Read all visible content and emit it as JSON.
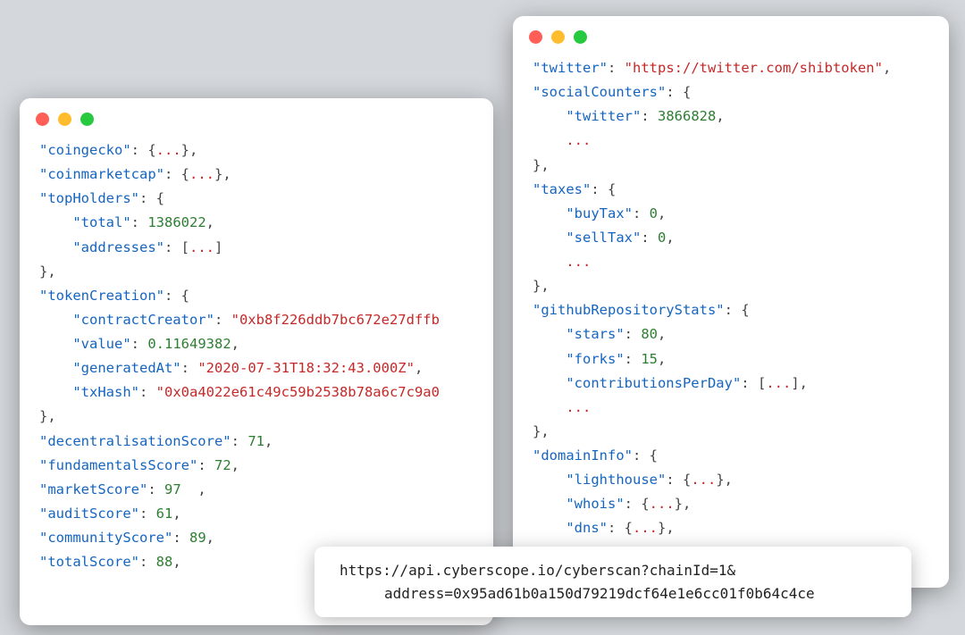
{
  "leftWindow": {
    "lines": {
      "coingecko_key": "\"coingecko\"",
      "coinmarketcap_key": "\"coinmarketcap\"",
      "topHolders_key": "\"topHolders\"",
      "total_key": "\"total\"",
      "total_val": "1386022",
      "addresses_key": "\"addresses\"",
      "tokenCreation_key": "\"tokenCreation\"",
      "contractCreator_key": "\"contractCreator\"",
      "contractCreator_val": "\"0xb8f226ddb7bc672e27dffb",
      "value_key": "\"value\"",
      "value_val": "0.11649382",
      "generatedAt_key": "\"generatedAt\"",
      "generatedAt_val": "\"2020-07-31T18:32:43.000Z\"",
      "txHash_key": "\"txHash\"",
      "txHash_val": "\"0x0a4022e61c49c59b2538b78a6c7c9a0",
      "decentralisationScore_key": "\"decentralisationScore\"",
      "decentralisationScore_val": "71",
      "fundamentalsScore_key": "\"fundamentalsScore\"",
      "fundamentalsScore_val": "72",
      "marketScore_key": "\"marketScore\"",
      "marketScore_val": "97",
      "auditScore_key": "\"auditScore\"",
      "auditScore_val": "61",
      "communityScore_key": "\"communityScore\"",
      "communityScore_val": "89",
      "totalScore_key": "\"totalScore\"",
      "totalScore_val": "88"
    }
  },
  "rightWindow": {
    "lines": {
      "twitter_key": "\"twitter\"",
      "twitter_val": "\"https://twitter.com/shibtoken\"",
      "socialCounters_key": "\"socialCounters\"",
      "sc_twitter_key": "\"twitter\"",
      "sc_twitter_val": "3866828",
      "taxes_key": "\"taxes\"",
      "buyTax_key": "\"buyTax\"",
      "buyTax_val": "0",
      "sellTax_key": "\"sellTax\"",
      "sellTax_val": "0",
      "githubRepositoryStats_key": "\"githubRepositoryStats\"",
      "stars_key": "\"stars\"",
      "stars_val": "80",
      "forks_key": "\"forks\"",
      "forks_val": "15",
      "contributionsPerDay_key": "\"contributionsPerDay\"",
      "domainInfo_key": "\"domainInfo\"",
      "lighthouse_key": "\"lighthouse\"",
      "whois_key": "\"whois\"",
      "dns_key": "\"dns\""
    }
  },
  "punct": {
    "colon": ": ",
    "comma": ",",
    "lbrace": "{",
    "rbrace": "}",
    "lbracket": "[",
    "rbracket": "]",
    "ellipsis": "..."
  },
  "urlBar": {
    "line1": "https://api.cyberscope.io/cyberscan?chainId=1&",
    "line2": "address=0x95ad61b0a150d79219dcf64e1e6cc01f0b64c4ce"
  }
}
